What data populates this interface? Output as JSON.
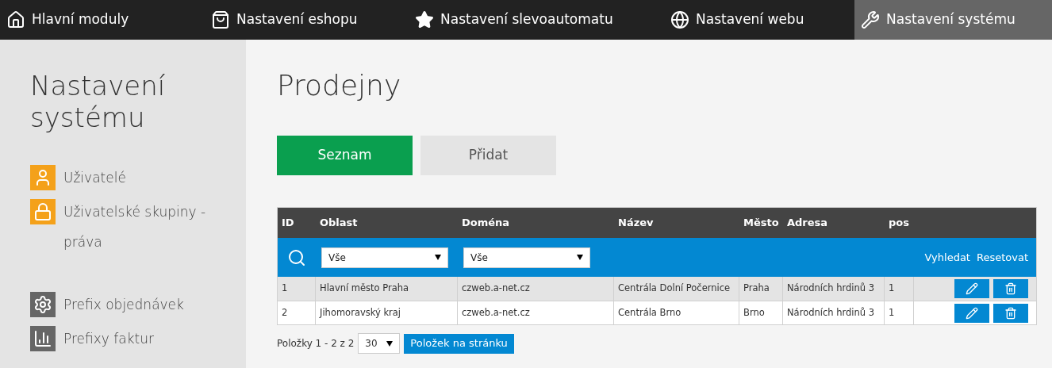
{
  "nav": [
    {
      "label": "Hlavní moduly",
      "selected": false
    },
    {
      "label": "Nastavení eshopu",
      "selected": false
    },
    {
      "label": "Nastavení slevoautomatu",
      "selected": false
    },
    {
      "label": "Nastavení webu",
      "selected": false
    },
    {
      "label": "Nastavení systému",
      "selected": true
    }
  ],
  "sidebar": {
    "title": "Nastavení systému",
    "groups": [
      [
        {
          "label": "Uživatelé",
          "color": "#f4a11a"
        },
        {
          "label": "Uživatelské skupiny - práva",
          "color": "#f4a11a"
        }
      ],
      [
        {
          "label": "Prefix objednávek",
          "color": "#666666"
        },
        {
          "label": "Prefixy faktur",
          "color": "#666666"
        }
      ]
    ]
  },
  "page_title": "Prodejny",
  "tabs": [
    {
      "label": "Seznam",
      "selected": true
    },
    {
      "label": "Přidat",
      "selected": false
    }
  ],
  "table": {
    "columns": [
      "ID",
      "Oblast",
      "Doména",
      "Název",
      "Město",
      "Adresa",
      "pos"
    ],
    "filters": [
      {
        "value": "Vše"
      },
      {
        "value": "Vše"
      }
    ],
    "filter_actions": [
      "Vyhledat",
      "Resetovat"
    ],
    "rows": [
      [
        "1",
        "Hlavní město Praha",
        "czweb.a-net.cz",
        "Centrála Dolní Počernice",
        "Praha",
        "Národních hrdinů 3",
        "1"
      ],
      [
        "2",
        "Jihomoravský kraj",
        "czweb.a-net.cz",
        "Centrála Brno",
        "Brno",
        "Národních hrdinů 3",
        "1"
      ]
    ]
  },
  "pager": {
    "info": "Položky 1 - 2 z 2",
    "page_size": "30",
    "button": "Položek na stránku"
  }
}
